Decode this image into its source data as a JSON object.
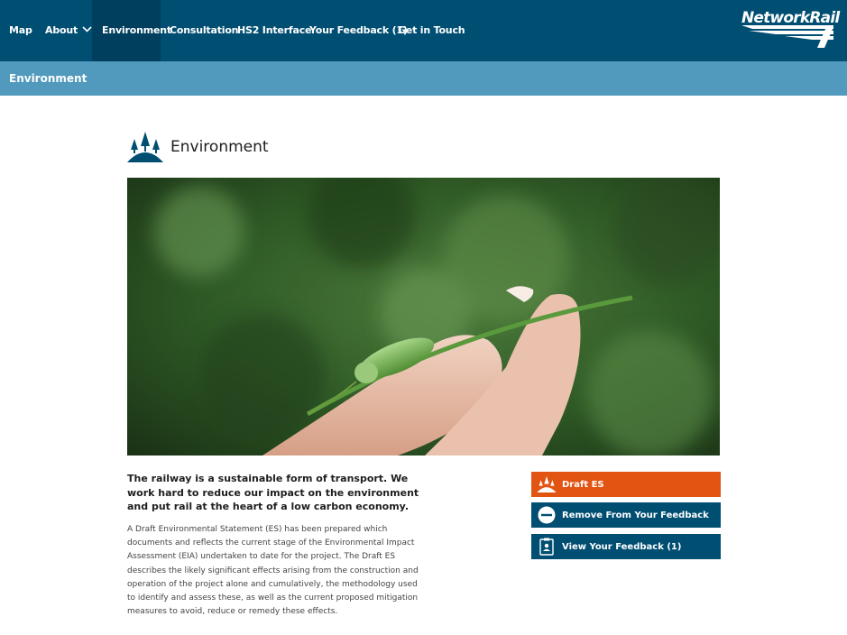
{
  "nav": {
    "items": [
      {
        "label": "Map"
      },
      {
        "label": "About"
      },
      {
        "label": "Environment"
      },
      {
        "label": "Consultation"
      },
      {
        "label": "HS2 Interface"
      },
      {
        "label": "Your Feedback (1)"
      },
      {
        "label": "Get in Touch"
      }
    ],
    "logo_text": "NetworkRail"
  },
  "subbar": {
    "title": "Environment"
  },
  "main": {
    "title": "Environment",
    "lead": "The railway is a sustainable form of transport. We work hard to reduce our impact on the environment and put rail at the heart of a low carbon economy.",
    "body": "A Draft Environmental Statement (ES) has been prepared which documents and reflects the current stage of the Environmental Impact Assessment (EIA) undertaken to date for the project. The Draft ES describes the likely significant effects arising from the construction and operation of the project alone and cumulatively, the methodology used to identify and assess these, as well as the current proposed mitigation measures to avoid, reduce or remedy these effects."
  },
  "actions": {
    "draft_es": "Draft ES",
    "remove": "Remove From Your Feedback",
    "view": "View Your Feedback (1)"
  },
  "colors": {
    "nav_bg": "#004e72",
    "subbar_bg": "#5199bd",
    "accent_orange": "#e25412"
  },
  "icons": [
    "chevron-down-icon",
    "trees-icon",
    "minus-circle-icon",
    "clipboard-icon",
    "network-rail-logo"
  ]
}
